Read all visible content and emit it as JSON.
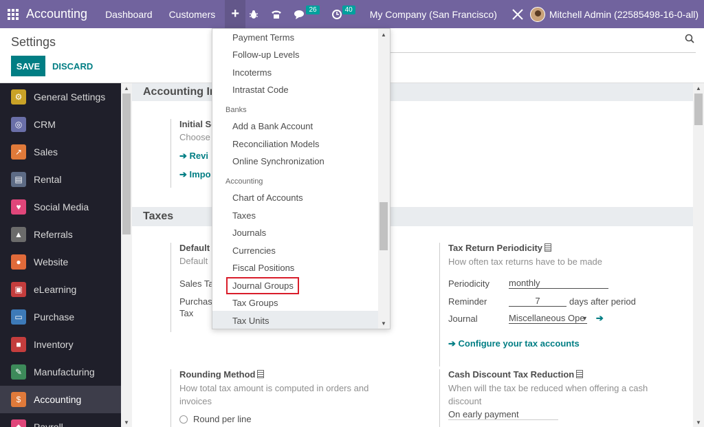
{
  "navbar": {
    "app_name": "Accounting",
    "menu": [
      "Dashboard",
      "Customers"
    ],
    "plus": "+",
    "messages_count": "26",
    "activities_count": "40",
    "company": "My Company (San Francisco)",
    "user": "Mitchell Admin (22585498-16-0-all)"
  },
  "control": {
    "title": "Settings",
    "save": "SAVE",
    "discard": "DISCARD"
  },
  "sidebar": {
    "items": [
      {
        "label": "General Settings",
        "color": "#c9a227"
      },
      {
        "label": "CRM",
        "color": "#6a6fa8"
      },
      {
        "label": "Sales",
        "color": "#e07a3a"
      },
      {
        "label": "Rental",
        "color": "#5d6b85"
      },
      {
        "label": "Social Media",
        "color": "#e0467a"
      },
      {
        "label": "Referrals",
        "color": "#6b6b6b"
      },
      {
        "label": "Website",
        "color": "#e06a3a"
      },
      {
        "label": "eLearning",
        "color": "#c43d3d"
      },
      {
        "label": "Purchase",
        "color": "#3d7ab8"
      },
      {
        "label": "Inventory",
        "color": "#c43d3d"
      },
      {
        "label": "Manufacturing",
        "color": "#3d8a5a"
      },
      {
        "label": "Accounting",
        "color": "#e07a3a"
      },
      {
        "label": "Payroll",
        "color": "#e0467a"
      }
    ]
  },
  "main": {
    "section1": "Accounting Im",
    "initial_title": "Initial Se",
    "initial_desc": "Choose",
    "link_review": "Revi",
    "link_import": "Impo",
    "section2": "Taxes",
    "default_title": "Default",
    "default_desc": "Default",
    "sales_tax": "Sales Ta",
    "purchase_tax_1": "Purchase",
    "purchase_tax_2": "Tax",
    "trp_title": "Tax Return Periodicity",
    "trp_desc": "How often tax returns have to be made",
    "periodicity_label": "Periodicity",
    "periodicity_value": "monthly",
    "reminder_label": "Reminder",
    "reminder_value": "7",
    "reminder_suffix": "days after period",
    "journal_label": "Journal",
    "journal_value": "Miscellaneous Ope",
    "configure_link": "Configure your tax accounts",
    "rounding_title": "Rounding Method",
    "rounding_desc": "How total tax amount is computed in orders and invoices",
    "rounding_option": "Round per line",
    "cash_title": "Cash Discount Tax Reduction",
    "cash_desc": "When will the tax be reduced when offering a cash discount",
    "cash_value": "On early payment"
  },
  "dropdown": {
    "items_top": [
      "Payment Terms",
      "Follow-up Levels",
      "Incoterms",
      "Intrastat Code"
    ],
    "header_banks": "Banks",
    "items_banks": [
      "Add a Bank Account",
      "Reconciliation Models",
      "Online Synchronization"
    ],
    "header_accounting": "Accounting",
    "items_accounting": [
      "Chart of Accounts",
      "Taxes",
      "Journals",
      "Currencies",
      "Fiscal Positions",
      "Journal Groups",
      "Tax Groups",
      "Tax Units"
    ]
  }
}
